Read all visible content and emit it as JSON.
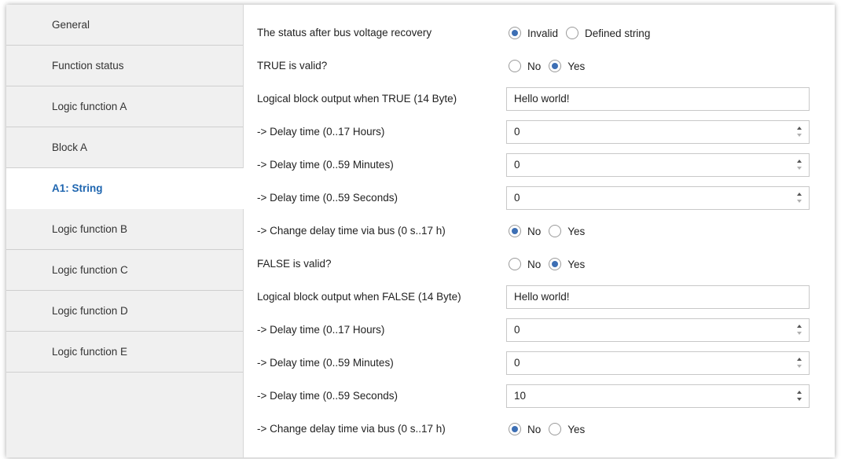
{
  "sidebar": {
    "items": [
      {
        "label": "General"
      },
      {
        "label": "Function status"
      },
      {
        "label": "Logic function A"
      },
      {
        "label": "Block A"
      },
      {
        "label": "A1: String"
      },
      {
        "label": "Logic function B"
      },
      {
        "label": "Logic function C"
      },
      {
        "label": "Logic function D"
      },
      {
        "label": "Logic function E"
      }
    ],
    "active_item": "A1: String"
  },
  "params": {
    "status_recovery": {
      "label": "The status after bus voltage recovery",
      "options": [
        "Invalid",
        "Defined string"
      ],
      "selected": "Invalid"
    },
    "true_valid": {
      "label": "TRUE is valid?",
      "options": [
        "No",
        "Yes"
      ],
      "selected": "Yes"
    },
    "true_output": {
      "label": "Logical block output when TRUE (14 Byte)",
      "value": "Hello world!"
    },
    "true_delay_hours": {
      "label": "-> Delay time (0..17 Hours)",
      "value": "0"
    },
    "true_delay_minutes": {
      "label": "-> Delay time (0..59 Minutes)",
      "value": "0"
    },
    "true_delay_seconds": {
      "label": "-> Delay time (0..59 Seconds)",
      "value": "0"
    },
    "true_change_delay": {
      "label": "-> Change delay time via bus (0 s..17 h)",
      "options": [
        "No",
        "Yes"
      ],
      "selected": "No"
    },
    "false_valid": {
      "label": "FALSE is valid?",
      "options": [
        "No",
        "Yes"
      ],
      "selected": "Yes"
    },
    "false_output": {
      "label": "Logical block output when FALSE (14 Byte)",
      "value": "Hello world!"
    },
    "false_delay_hours": {
      "label": "-> Delay time (0..17 Hours)",
      "value": "0"
    },
    "false_delay_minutes": {
      "label": "-> Delay time (0..59 Minutes)",
      "value": "0"
    },
    "false_delay_seconds": {
      "label": "-> Delay time (0..59 Seconds)",
      "value": "10"
    },
    "false_change_delay": {
      "label": "-> Change delay time via bus (0 s..17 h)",
      "options": [
        "No",
        "Yes"
      ],
      "selected": "No"
    }
  },
  "colors": {
    "accent": "#1f66b0",
    "radio_selected": "#3d6fb4",
    "sidebar_bg": "#f0f0f0"
  }
}
